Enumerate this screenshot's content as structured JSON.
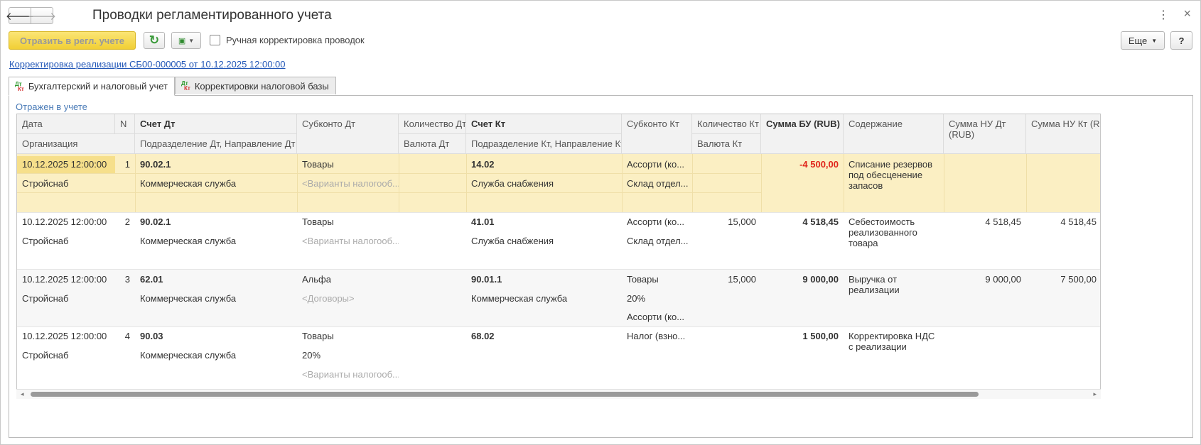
{
  "window": {
    "title": "Проводки регламентированного учета",
    "nav_back": "🡐",
    "nav_forward": "🡒",
    "menu_icon": "kebab-icon",
    "close_icon": "close-icon"
  },
  "toolbar": {
    "post_label": "Отразить в регл. учете",
    "refresh_icon": "refresh-icon",
    "docs_icon": "documents-icon",
    "manual_label": "Ручная корректировка проводок",
    "more_label": "Еще",
    "help_label": "?"
  },
  "doc_link": "Корректировка реализации СБ00-000005 от 10.12.2025 12:00:00",
  "tabs": [
    {
      "label": "Бухгалтерский и налоговый учет",
      "icon_top": "Дт",
      "icon_bottom": "Кт"
    },
    {
      "label": "Корректировки налоговой базы",
      "icon_top": "Дт",
      "icon_bottom": "Кт"
    }
  ],
  "status": "Отражен в учете",
  "headers": {
    "date": "Дата",
    "n": "N",
    "acct_dt": "Счет Дт",
    "subconto_dt": "Субконто Дт",
    "qty_dt": "Количество Дт",
    "acct_kt": "Счет Кт",
    "subconto_kt": "Субконто Кт",
    "qty_kt": "Количество Кт",
    "sum_bu": "Сумма БУ (RUB)",
    "content": "Содержание",
    "sum_nu_dt": "Сумма НУ Дт (RUB)",
    "sum_nu_kt": "Сумма НУ Кт (RUB)",
    "org": "Организация",
    "dept_dt": "Подразделение Дт, Направление Дт",
    "currency_dt": "Валюта Дт",
    "dept_kt": "Подразделение Кт, Направление Кт",
    "currency_kt": "Валюта Кт"
  },
  "rows": [
    {
      "date": "10.12.2025 12:00:00",
      "n": "1",
      "org": "Стройснаб",
      "acct_dt": "90.02.1",
      "dept_dt": "Коммерческая служба",
      "sub_dt": [
        "Товары",
        "<Варианты налогооб..."
      ],
      "acct_kt": "14.02",
      "dept_kt": "Служба снабжения",
      "sub_kt": [
        "Ассорти (ко...",
        "Склад отдел..."
      ],
      "qty_kt": "",
      "sum_bu": "-4 500,00",
      "content": "Списание резервов под обесценение запасов",
      "nu_dt": "",
      "nu_kt": ""
    },
    {
      "date": "10.12.2025 12:00:00",
      "n": "2",
      "org": "Стройснаб",
      "acct_dt": "90.02.1",
      "dept_dt": "Коммерческая служба",
      "sub_dt": [
        "Товары",
        "<Варианты налогооб..."
      ],
      "acct_kt": "41.01",
      "dept_kt": "Служба снабжения",
      "sub_kt": [
        "Ассорти (ко...",
        "Склад отдел..."
      ],
      "qty_kt": "15,000",
      "sum_bu": "4 518,45",
      "content": "Себестоимость реализованного товара",
      "nu_dt": "4 518,45",
      "nu_kt": "4 518,45"
    },
    {
      "date": "10.12.2025 12:00:00",
      "n": "3",
      "org": "Стройснаб",
      "acct_dt": "62.01",
      "dept_dt": "Коммерческая служба",
      "sub_dt": [
        "Альфа",
        "<Договоры>"
      ],
      "acct_kt": "90.01.1",
      "dept_kt": "Коммерческая служба",
      "sub_kt": [
        "Товары",
        "20%",
        "Ассорти (ко..."
      ],
      "qty_kt": "15,000",
      "sum_bu": "9 000,00",
      "content": "Выручка от реализации",
      "nu_dt": "9 000,00",
      "nu_kt": "7 500,00"
    },
    {
      "date": "10.12.2025 12:00:00",
      "n": "4",
      "org": "Стройснаб",
      "acct_dt": "90.03",
      "dept_dt": "Коммерческая служба",
      "sub_dt": [
        "Товары",
        "20%",
        "<Варианты налогооб..."
      ],
      "acct_kt": "68.02",
      "dept_kt": "",
      "sub_kt": [
        "Налог (взно..."
      ],
      "qty_kt": "",
      "sum_bu": "1 500,00",
      "content": "Корректировка НДС с реализации",
      "nu_dt": "",
      "nu_kt": ""
    }
  ]
}
